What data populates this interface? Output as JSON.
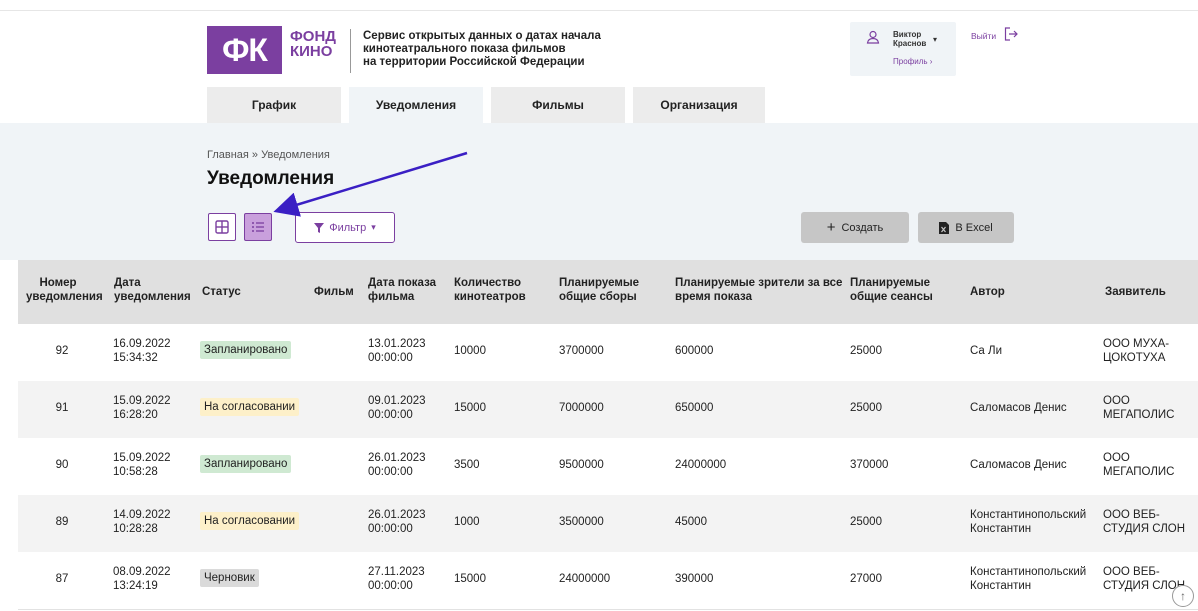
{
  "header": {
    "logo_mark": "ФК",
    "logo_line1": "ФОНД",
    "logo_line2": "КИНО",
    "service_line1": "Сервис открытых данных о датах начала",
    "service_line2": "кинотеатрального показа фильмов",
    "service_line3": "на территории Российской Федерации",
    "user_first": "Виктор",
    "user_last": "Краснов",
    "profile_link": "Профиль ›",
    "logout": "Выйти"
  },
  "tabs": [
    {
      "label": "График"
    },
    {
      "label": "Уведомления"
    },
    {
      "label": "Фильмы"
    },
    {
      "label": "Организация"
    }
  ],
  "breadcrumb": "Главная » Уведомления",
  "page_title": "Уведомления",
  "toolbar": {
    "filter_label": "Фильтр",
    "create_label": "Создать",
    "excel_label": "В Excel"
  },
  "table": {
    "headers": {
      "number": [
        "Номер",
        "уведомления"
      ],
      "date": [
        "Дата",
        "уведомления"
      ],
      "status": "Статус",
      "film": "Фильм",
      "show_date": [
        "Дата показа",
        "фильма"
      ],
      "cinemas": [
        "Количество",
        "кинотеатров"
      ],
      "gross": [
        "Планируемые",
        "общие сборы"
      ],
      "viewers": [
        "Планируемые зрители за все",
        "время показа"
      ],
      "sessions": [
        "Планируемые",
        "общие сеансы"
      ],
      "author": "Автор",
      "applicant": "Заявитель"
    },
    "rows": [
      {
        "number": "92",
        "date1": "16.09.2022",
        "date2": "15:34:32",
        "status": "Запланировано",
        "status_color": "green",
        "show1": "13.01.2023",
        "show2": "00:00:00",
        "cinemas": "10000",
        "gross": "3700000",
        "viewers": "600000",
        "sessions": "25000",
        "author1": "Са Ли",
        "author2": "",
        "applicant1": "ООО МУХА-",
        "applicant2": "ЦОКОТУХА"
      },
      {
        "number": "91",
        "date1": "15.09.2022",
        "date2": "16:28:20",
        "status": "На согласовании",
        "status_color": "yellow",
        "show1": "09.01.2023",
        "show2": "00:00:00",
        "cinemas": "15000",
        "gross": "7000000",
        "viewers": "650000",
        "sessions": "25000",
        "author1": "Саломасов Денис",
        "author2": "",
        "applicant1": "ООО",
        "applicant2": "МЕГАПОЛИС"
      },
      {
        "number": "90",
        "date1": "15.09.2022",
        "date2": "10:58:28",
        "status": "Запланировано",
        "status_color": "green",
        "show1": "26.01.2023",
        "show2": "00:00:00",
        "cinemas": "3500",
        "gross": "9500000",
        "viewers": "24000000",
        "sessions": "370000",
        "author1": "Саломасов Денис",
        "author2": "",
        "applicant1": "ООО",
        "applicant2": "МЕГАПОЛИС"
      },
      {
        "number": "89",
        "date1": "14.09.2022",
        "date2": "10:28:28",
        "status": "На согласовании",
        "status_color": "yellow",
        "show1": "26.01.2023",
        "show2": "00:00:00",
        "cinemas": "1000",
        "gross": "3500000",
        "viewers": "45000",
        "sessions": "25000",
        "author1": "Константинопольский",
        "author2": "Константин",
        "applicant1": "ООО ВЕБ-",
        "applicant2": "СТУДИЯ СЛОН"
      },
      {
        "number": "87",
        "date1": "08.09.2022",
        "date2": "13:24:19",
        "status": "Черновик",
        "status_color": "gray",
        "show1": "27.11.2023",
        "show2": "00:00:00",
        "cinemas": "15000",
        "gross": "24000000",
        "viewers": "390000",
        "sessions": "27000",
        "author1": "Константинопольский",
        "author2": "Константин",
        "applicant1": "ООО ВЕБ-",
        "applicant2": "СТУДИЯ СЛОН"
      }
    ]
  },
  "colors": {
    "brand": "#7b3fa0",
    "accent_light": "#c9a0dc",
    "arrow": "#3a1fc4"
  }
}
